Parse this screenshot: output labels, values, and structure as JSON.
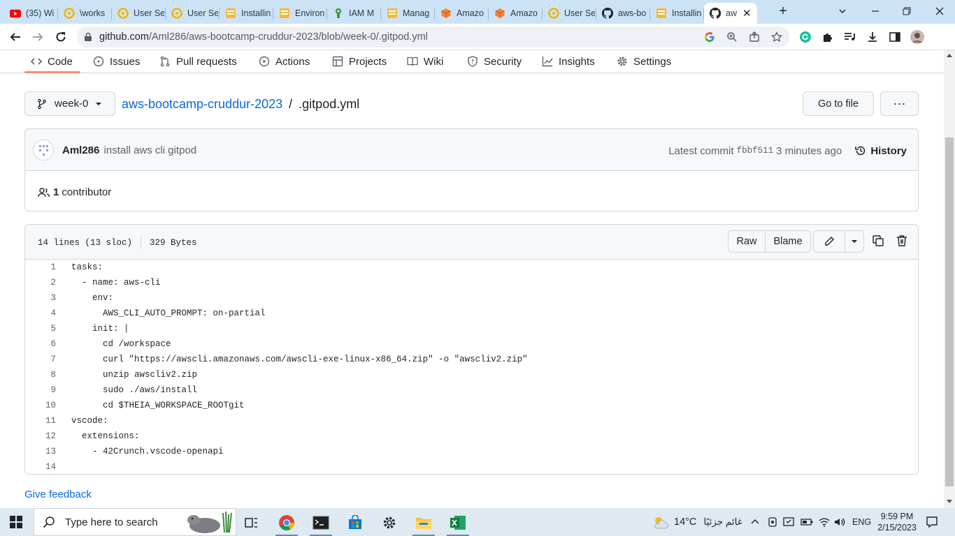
{
  "chrome": {
    "tabs": [
      {
        "title": "(35) Wi",
        "icon": "youtube-icon",
        "active": false
      },
      {
        "title": "\\works",
        "icon": "chrome-icon",
        "active": false
      },
      {
        "title": "User Se",
        "icon": "chrome-icon",
        "active": false
      },
      {
        "title": "User Se",
        "icon": "chrome-icon",
        "active": false
      },
      {
        "title": "Installin",
        "icon": "aws-docs-icon",
        "active": false
      },
      {
        "title": "Environ",
        "icon": "aws-docs-icon",
        "active": false
      },
      {
        "title": "IAM M",
        "icon": "iam-icon",
        "active": false
      },
      {
        "title": "Manag",
        "icon": "aws-docs-icon",
        "active": false
      },
      {
        "title": "Amazo",
        "icon": "aws-orange-icon",
        "active": false
      },
      {
        "title": "Amazo",
        "icon": "aws-orange-icon",
        "active": false
      },
      {
        "title": "User Se",
        "icon": "chrome-icon",
        "active": false
      },
      {
        "title": "aws-bo",
        "icon": "github-icon",
        "active": false
      },
      {
        "title": "Installin",
        "icon": "aws-docs-icon",
        "active": false
      },
      {
        "title": "aw",
        "icon": "github-icon",
        "active": true
      }
    ],
    "url_host": "github.com",
    "url_path": "/Aml286/aws-bootcamp-cruddur-2023/blob/week-0/.gitpod.yml"
  },
  "repo_nav": {
    "tabs": [
      {
        "label": "Code",
        "icon": "code-icon"
      },
      {
        "label": "Issues",
        "icon": "issue-icon"
      },
      {
        "label": "Pull requests",
        "icon": "pull-request-icon"
      },
      {
        "label": "Actions",
        "icon": "play-icon"
      },
      {
        "label": "Projects",
        "icon": "table-icon"
      },
      {
        "label": "Wiki",
        "icon": "book-icon"
      },
      {
        "label": "Security",
        "icon": "shield-icon"
      },
      {
        "label": "Insights",
        "icon": "graph-icon"
      },
      {
        "label": "Settings",
        "icon": "gear-icon"
      }
    ],
    "selected": "Code"
  },
  "file_header": {
    "branch": "week-0",
    "repo_link": "aws-bootcamp-cruddur-2023",
    "separator": "/",
    "file_name": ".gitpod.yml",
    "go_to_file": "Go to file",
    "more": "···"
  },
  "commit": {
    "author": "Aml286",
    "message": "install aws cli gitpod",
    "latest_label": "Latest commit",
    "sha": "fbbf511",
    "time": "3 minutes ago",
    "history": "History"
  },
  "contributors": {
    "count": "1",
    "label": "contributor"
  },
  "file_info": {
    "lines": "14 lines (13 sloc)",
    "size": "329 Bytes",
    "raw": "Raw",
    "blame": "Blame"
  },
  "code_lines": [
    "tasks:",
    "  - name: aws-cli",
    "    env:",
    "      AWS_CLI_AUTO_PROMPT: on-partial",
    "    init: |",
    "      cd /workspace",
    "      curl \"https://awscli.amazonaws.com/awscli-exe-linux-x86_64.zip\" -o \"awscliv2.zip\"",
    "      unzip awscliv2.zip",
    "      sudo ./aws/install",
    "      cd $THEIA_WORKSPACE_ROOTgit",
    "vscode:",
    "  extensions:",
    "    - 42Crunch.vscode-openapi",
    ""
  ],
  "feedback": "Give feedback",
  "taskbar": {
    "search_placeholder": "Type here to search",
    "weather_temp": "14°C",
    "weather_text": "غائم جزئيًا",
    "lang": "ENG",
    "time": "9:59 PM",
    "date": "2/15/2023"
  },
  "colors": {
    "accent_link": "#0969da",
    "selected_tab_underline": "#fd8c73",
    "chrome_tab_bar": "#cce3f7",
    "taskbar": "#dfe9f1"
  }
}
